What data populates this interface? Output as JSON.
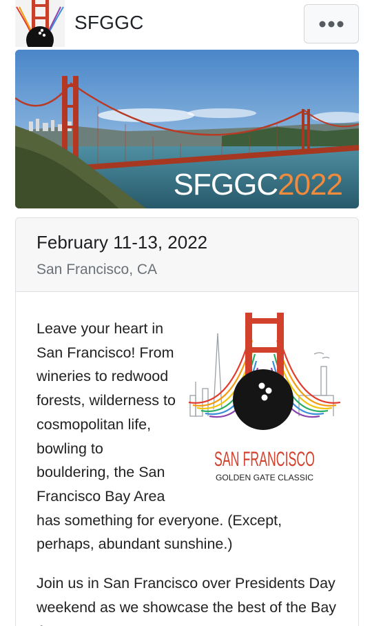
{
  "header": {
    "site_title": "SFGGC",
    "menu_icon": "ellipsis-icon"
  },
  "banner": {
    "text_white": "SFGGC",
    "text_orange": "2022",
    "colors": {
      "orange": "#f08a3c",
      "bridge": "#b83a24"
    }
  },
  "event": {
    "date": "February 11-13, 2022",
    "location": "San Francisco, CA",
    "logo": {
      "title": "SAN FRANCISCO",
      "subtitle": "GOLDEN GATE CLASSIC"
    },
    "paragraph1": "Leave your heart in San Francisco! From wineries to redwood forests, wilderness to cosmopolitan life, bowling to bouldering, the San Francisco Bay Area has something for everyone. (Except, perhaps, abundant sunshine.)",
    "paragraph2": "Join us in San Francisco over Presidents Day weekend as we showcase the best of the Bay Area."
  }
}
